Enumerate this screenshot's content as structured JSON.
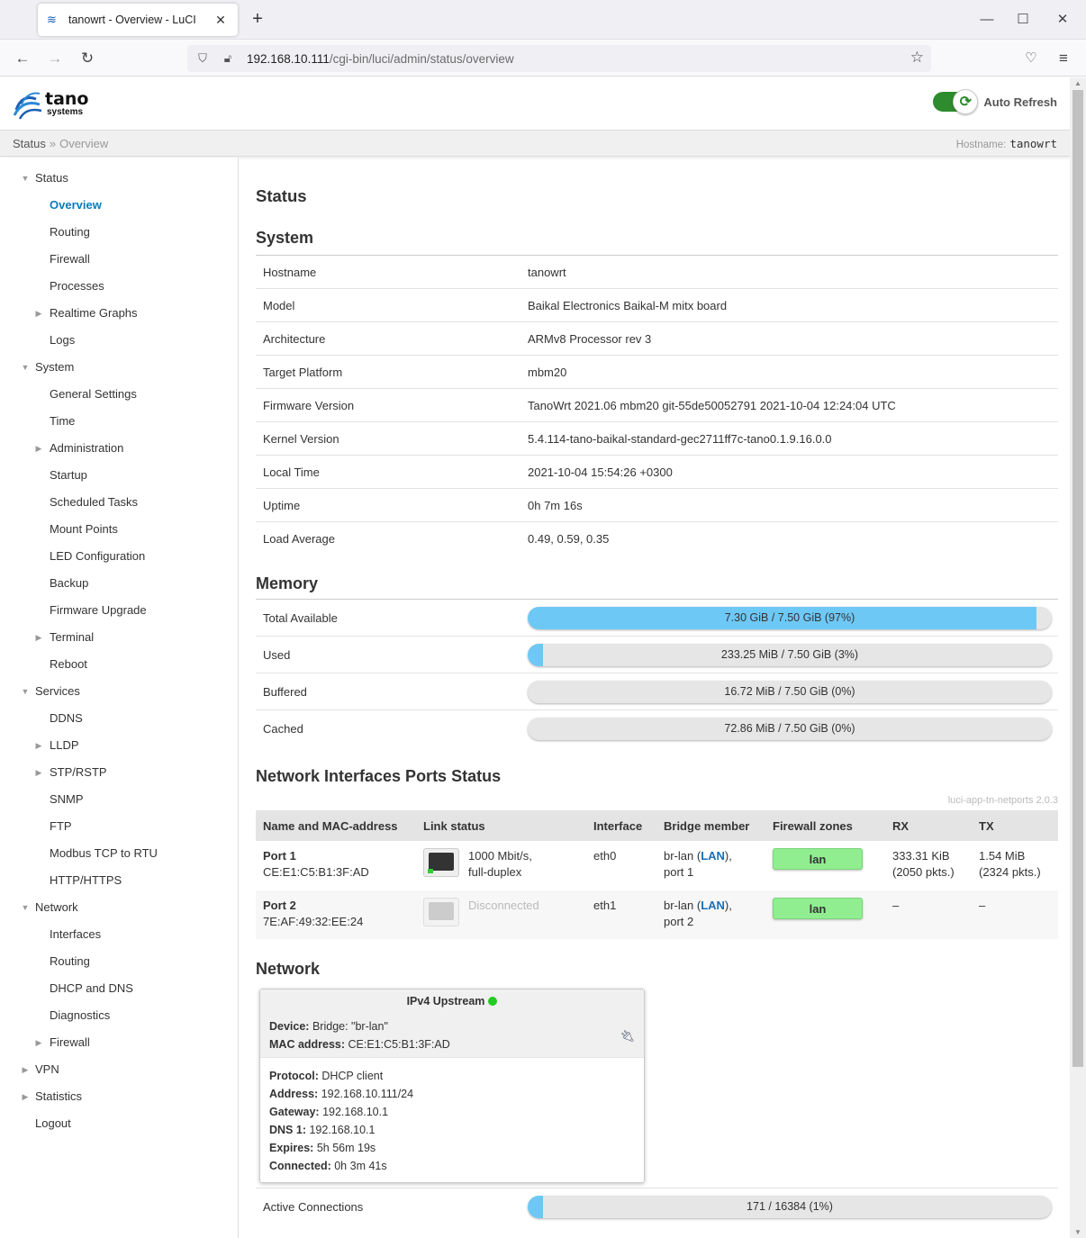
{
  "browser": {
    "tab_title": "tanowrt - Overview - LuCI",
    "url_host": "192.168.10.111",
    "url_path": "/cgi-bin/luci/admin/status/overview"
  },
  "header": {
    "logo_text": "tano",
    "logo_subtext": "systems",
    "auto_refresh_label": "Auto Refresh",
    "auto_refresh_on": true
  },
  "breadcrumb": {
    "root": "Status",
    "separator": "»",
    "current": "Overview",
    "hostname_label": "Hostname:",
    "hostname_value": "tanowrt"
  },
  "sidebar": {
    "status": "Status",
    "status_items": [
      "Overview",
      "Routing",
      "Firewall",
      "Processes",
      "Realtime Graphs",
      "Logs"
    ],
    "system": "System",
    "system_items": [
      "General Settings",
      "Time",
      "Administration",
      "Startup",
      "Scheduled Tasks",
      "Mount Points",
      "LED Configuration",
      "Backup",
      "Firmware Upgrade",
      "Terminal",
      "Reboot"
    ],
    "services": "Services",
    "services_items": [
      "DDNS",
      "LLDP",
      "STP/RSTP",
      "SNMP",
      "FTP",
      "Modbus TCP to RTU",
      "HTTP/HTTPS"
    ],
    "network": "Network",
    "network_items": [
      "Interfaces",
      "Routing",
      "DHCP and DNS",
      "Diagnostics",
      "Firewall"
    ],
    "vpn": "VPN",
    "statistics": "Statistics",
    "logout": "Logout"
  },
  "main": {
    "title": "Status",
    "system": {
      "heading": "System",
      "rows": [
        {
          "k": "Hostname",
          "v": "tanowrt"
        },
        {
          "k": "Model",
          "v": "Baikal Electronics Baikal-M mitx board"
        },
        {
          "k": "Architecture",
          "v": "ARMv8 Processor rev 3"
        },
        {
          "k": "Target Platform",
          "v": "mbm20"
        },
        {
          "k": "Firmware Version",
          "v": "TanoWrt 2021.06 mbm20 git-55de50052791 2021-10-04 12:24:04 UTC"
        },
        {
          "k": "Kernel Version",
          "v": "5.4.114-tano-baikal-standard-gec2711ff7c-tano0.1.9.16.0.0"
        },
        {
          "k": "Local Time",
          "v": "2021-10-04 15:54:26 +0300"
        },
        {
          "k": "Uptime",
          "v": "0h 7m 16s"
        },
        {
          "k": "Load Average",
          "v": "0.49, 0.59, 0.35"
        }
      ]
    },
    "memory": {
      "heading": "Memory",
      "rows": [
        {
          "k": "Total Available",
          "text": "7.30 GiB / 7.50 GiB (97%)",
          "fraction": 0.97
        },
        {
          "k": "Used",
          "text": "233.25 MiB / 7.50 GiB (3%)",
          "fraction": 0.03
        },
        {
          "k": "Buffered",
          "text": "16.72 MiB / 7.50 GiB (0%)",
          "fraction": 0.0
        },
        {
          "k": "Cached",
          "text": "72.86 MiB / 7.50 GiB (0%)",
          "fraction": 0.0
        }
      ]
    },
    "ports": {
      "heading": "Network Interfaces Ports Status",
      "plugin": "luci-app-tn-netports 2.0.3",
      "columns": [
        "Name and MAC-address",
        "Link status",
        "Interface",
        "Bridge member",
        "Firewall zones",
        "RX",
        "TX"
      ],
      "rows": [
        {
          "name": "Port 1",
          "mac": "CE:E1:C5:B1:3F:AD",
          "link1": "1000 Mbit/s,",
          "link2": "full-duplex",
          "iface": "eth0",
          "bridge_pre": "br-lan (",
          "bridge_link": "LAN",
          "bridge_post": "),",
          "bridge_port": "port 1",
          "zone": "lan",
          "rx1": "333.31 KiB",
          "rx2": "(2050 pkts.)",
          "tx1": "1.54 MiB",
          "tx2": "(2324 pkts.)"
        },
        {
          "name": "Port 2",
          "mac": "7E:AF:49:32:EE:24",
          "link1": "Disconnected",
          "link2": "",
          "iface": "eth1",
          "bridge_pre": "br-lan (",
          "bridge_link": "LAN",
          "bridge_post": "),",
          "bridge_port": "port 2",
          "zone": "lan",
          "rx1": "–",
          "rx2": "",
          "tx1": "–",
          "tx2": ""
        }
      ]
    },
    "network": {
      "heading": "Network",
      "box_title": "IPv4 Upstream",
      "device_label": "Device:",
      "device": "Bridge: \"br-lan\"",
      "mac_label": "MAC address:",
      "mac": "CE:E1:C5:B1:3F:AD",
      "protocol_label": "Protocol:",
      "protocol": "DHCP client",
      "address_label": "Address:",
      "address": "192.168.10.111/24",
      "gateway_label": "Gateway:",
      "gateway": "192.168.10.1",
      "dns_label": "DNS 1:",
      "dns": "192.168.10.1",
      "expires_label": "Expires:",
      "expires": "5h 56m 19s",
      "connected_label": "Connected:",
      "connected": "0h 3m 41s",
      "active_conn_label": "Active Connections",
      "active_conn_text": "171 / 16384 (1%)",
      "active_conn_fraction": 0.01
    }
  },
  "colors": {
    "accent": "#0a7bbd",
    "bar_fill": "#6ec8f5",
    "zone_lan": "#90ee90",
    "toggle_on": "#2e8b2e"
  }
}
